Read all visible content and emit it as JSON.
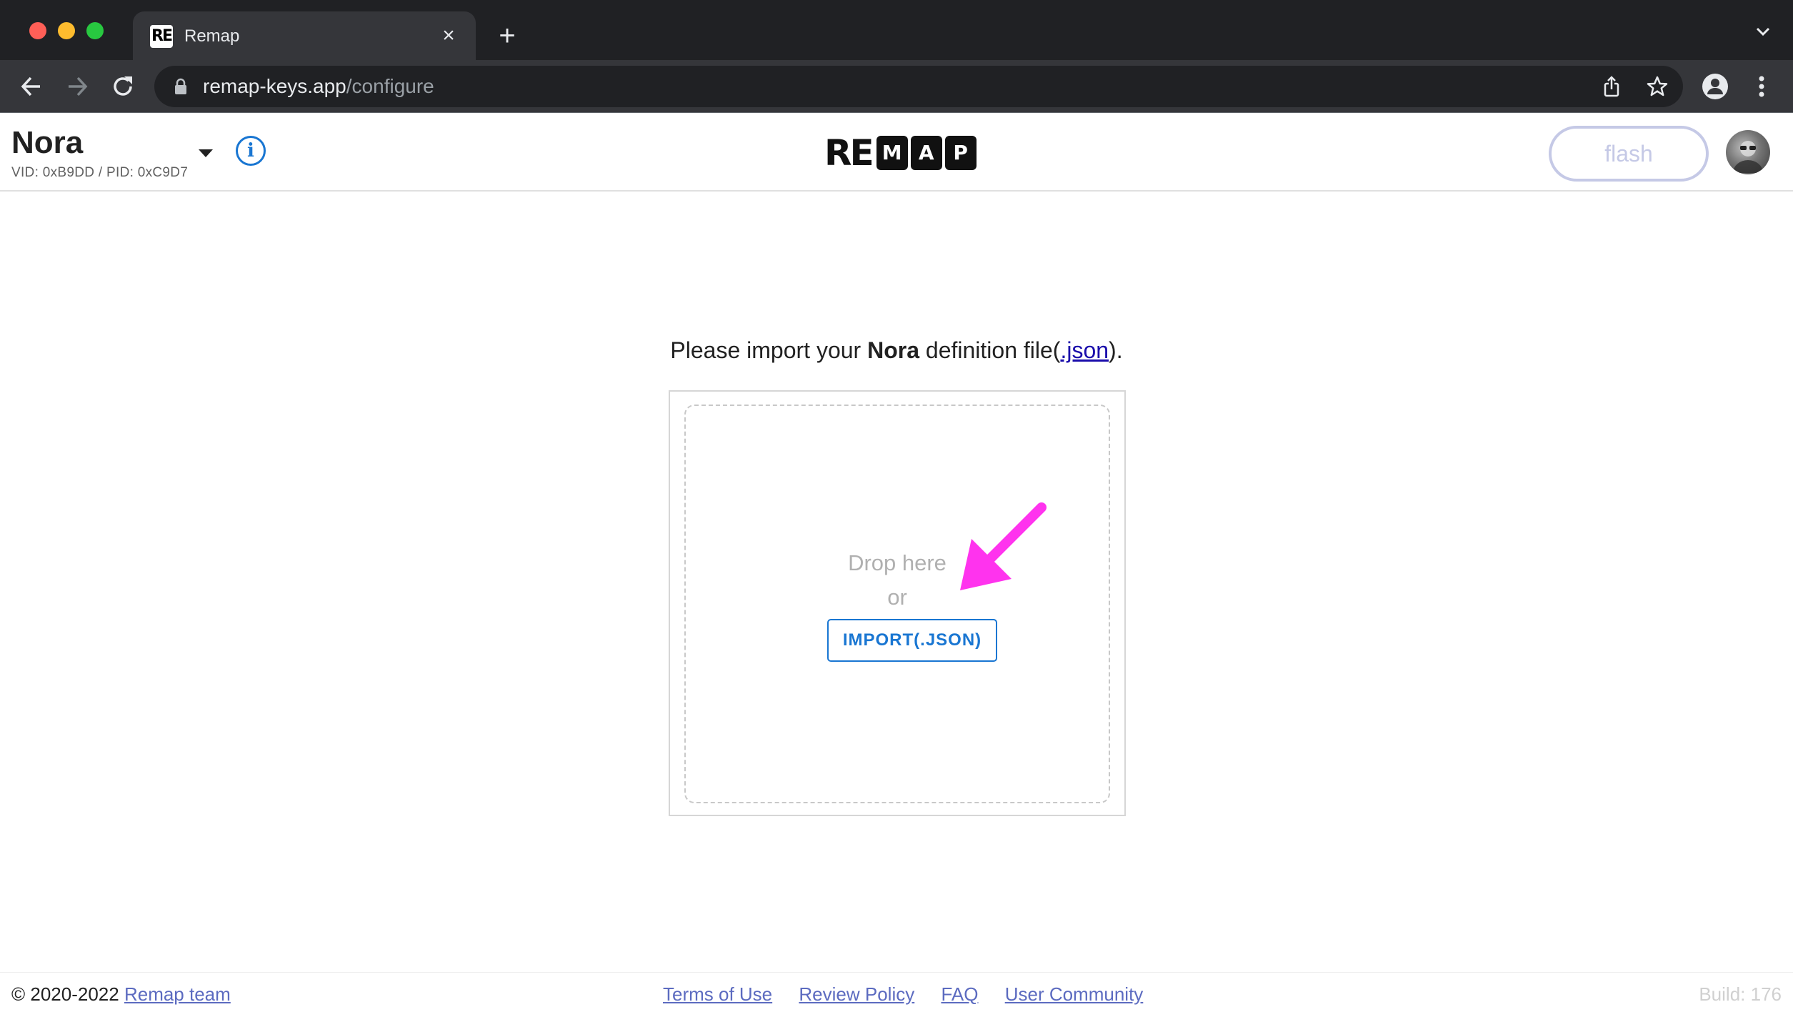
{
  "browser": {
    "tab_title": "Remap",
    "tab_favicon_text": "RE",
    "url_host": "remap-keys.app",
    "url_path": "/configure"
  },
  "header": {
    "keyboard_name": "Nora",
    "keyboard_ids": "VID: 0xB9DD / PID: 0xC9D7",
    "info_symbol": "i",
    "logo_prefix": "RE",
    "logo_keys": [
      "M",
      "A",
      "P"
    ],
    "flash_label": "flash"
  },
  "main": {
    "prompt_before": "Please import your ",
    "prompt_keyboard": "Nora",
    "prompt_middle": " definition file(",
    "prompt_link": ".json",
    "prompt_after": ").",
    "drop_here": "Drop here",
    "or": "or",
    "import_label": "IMPORT(.JSON)",
    "annotation_arrow_color": "#ff33ee"
  },
  "footer": {
    "copyright": "© 2020-2022 ",
    "team_link": "Remap team",
    "links": [
      "Terms of Use",
      "Review Policy",
      "FAQ",
      "User Community"
    ],
    "build": "Build: 176"
  }
}
